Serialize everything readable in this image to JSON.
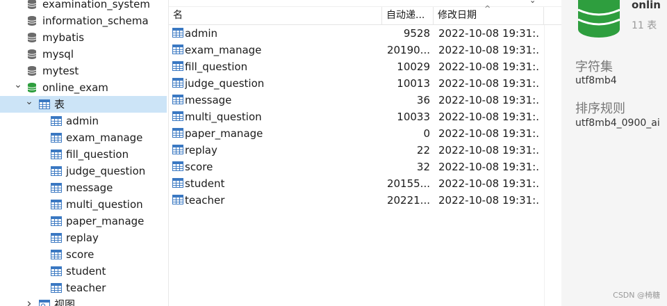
{
  "sidebar": {
    "databases_above": [
      {
        "label": "examination_system",
        "icon": "database-icon-gray"
      },
      {
        "label": "information_schema",
        "icon": "database-icon-gray"
      },
      {
        "label": "mybatis",
        "icon": "database-icon-gray"
      },
      {
        "label": "mysql",
        "icon": "database-icon-gray"
      },
      {
        "label": "mytest",
        "icon": "database-icon-gray"
      }
    ],
    "open_database": {
      "label": "online_exam",
      "icon": "database-icon-green",
      "expanded": true
    },
    "tables_group": {
      "label": "表",
      "expanded": true,
      "selected": true
    },
    "tables": [
      "admin",
      "exam_manage",
      "fill_question",
      "judge_question",
      "message",
      "multi_question",
      "paper_manage",
      "replay",
      "score",
      "student",
      "teacher"
    ],
    "views_group": {
      "label": "视图",
      "expanded": false
    }
  },
  "table_list": {
    "columns": {
      "name": "名",
      "auto_increment": "自动递...",
      "modified": "修改日期"
    },
    "sort_indicator": "^",
    "rows": [
      {
        "name": "admin",
        "auto_increment": "9528",
        "modified": "2022-10-08 19:31:..."
      },
      {
        "name": "exam_manage",
        "auto_increment": "20190...",
        "modified": "2022-10-08 19:31:..."
      },
      {
        "name": "fill_question",
        "auto_increment": "10029",
        "modified": "2022-10-08 19:31:..."
      },
      {
        "name": "judge_question",
        "auto_increment": "10013",
        "modified": "2022-10-08 19:31:..."
      },
      {
        "name": "message",
        "auto_increment": "36",
        "modified": "2022-10-08 19:31:..."
      },
      {
        "name": "multi_question",
        "auto_increment": "10033",
        "modified": "2022-10-08 19:31:..."
      },
      {
        "name": "paper_manage",
        "auto_increment": "0",
        "modified": "2022-10-08 19:31:..."
      },
      {
        "name": "replay",
        "auto_increment": "22",
        "modified": "2022-10-08 19:31:..."
      },
      {
        "name": "score",
        "auto_increment": "32",
        "modified": "2022-10-08 19:31:..."
      },
      {
        "name": "student",
        "auto_increment": "20155...",
        "modified": "2022-10-08 19:31:..."
      },
      {
        "name": "teacher",
        "auto_increment": "20221...",
        "modified": "2022-10-08 19:31:..."
      }
    ]
  },
  "info_panel": {
    "title": "onlin",
    "table_count": "11 表",
    "charset_label": "字符集",
    "charset_value": "utf8mb4",
    "collation_label": "排序规则",
    "collation_value": "utf8mb4_0900_ai"
  },
  "watermark": "CSDN @椅糖",
  "colors": {
    "selection": "#cce4f7",
    "db_green": "#2e9e3e",
    "db_gray": "#6b6b6b",
    "table_icon_blue": "#3a78c2"
  }
}
